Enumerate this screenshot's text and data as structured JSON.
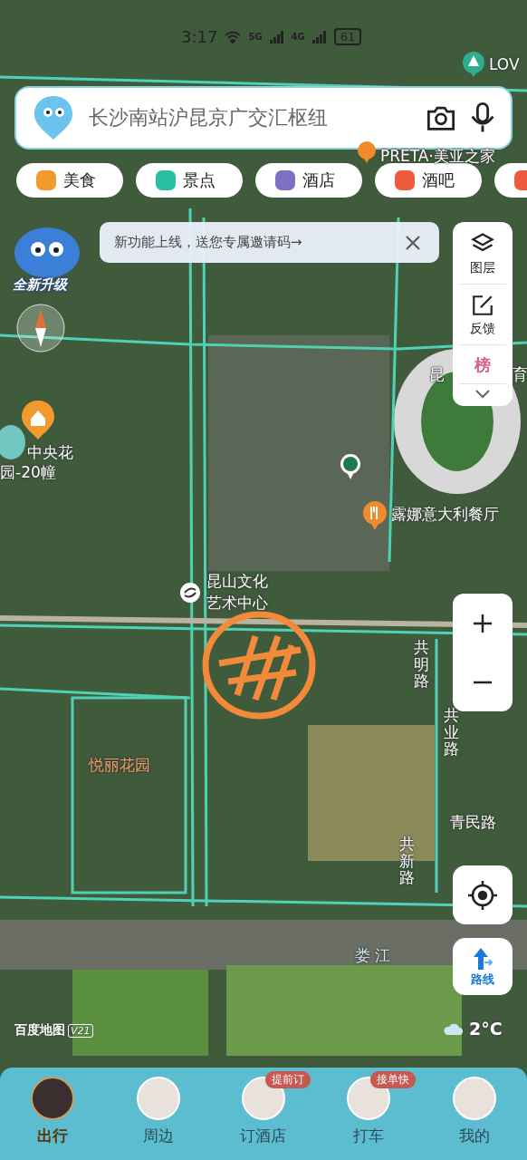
{
  "status_bar": {
    "time": "3:17",
    "network_1": "5G",
    "network_2": "4G",
    "battery": "61"
  },
  "search": {
    "placeholder": "长沙南站沪昆京广交汇枢纽"
  },
  "categories": [
    {
      "label": "美食",
      "color": "#f29a2e"
    },
    {
      "label": "景点",
      "color": "#27bfa0"
    },
    {
      "label": "酒店",
      "color": "#7d6fc4"
    },
    {
      "label": "酒吧",
      "color": "#ee5a3c"
    },
    {
      "color": "#ee5a3c"
    }
  ],
  "notice": {
    "text": "新功能上线，送您专属邀请码→"
  },
  "mascot_badge": "全新升级",
  "side_tools": [
    {
      "kind": "layers",
      "label": "图层"
    },
    {
      "kind": "feedback",
      "label": "反馈"
    },
    {
      "kind": "ranking",
      "icon_text": "榜"
    }
  ],
  "map_labels": [
    {
      "kind": "poi",
      "text": "LOV"
    },
    {
      "kind": "poi",
      "text": "PRETA·美亚之家"
    },
    {
      "kind": "poi",
      "text": "昆"
    },
    {
      "kind": "poi",
      "text": "育"
    },
    {
      "kind": "poi",
      "text": "中央花"
    },
    {
      "kind": "poi",
      "text": "园-20幢"
    },
    {
      "kind": "poi",
      "text": "露娜意大利餐厅"
    },
    {
      "kind": "poi",
      "text": "昆山文化"
    },
    {
      "kind": "poi",
      "text": "艺术中心"
    },
    {
      "kind": "road",
      "text": "共明路"
    },
    {
      "kind": "road",
      "text": "共业路"
    },
    {
      "kind": "poi",
      "text": "青民路"
    },
    {
      "kind": "road",
      "text": "共新路"
    },
    {
      "kind": "area",
      "text": "悦丽花园"
    },
    {
      "kind": "water",
      "text": "娄 江"
    }
  ],
  "route_button": "路线",
  "weather": "2°C",
  "brand": {
    "name": "百度地图",
    "version": "V21"
  },
  "nav": [
    {
      "label": "出行",
      "selected": true
    },
    {
      "label": "周边",
      "selected": false
    },
    {
      "label": "订酒店",
      "selected": false,
      "badge": "提前订"
    },
    {
      "label": "打车",
      "selected": false,
      "badge": "接单快"
    },
    {
      "label": "我的",
      "selected": false
    }
  ]
}
